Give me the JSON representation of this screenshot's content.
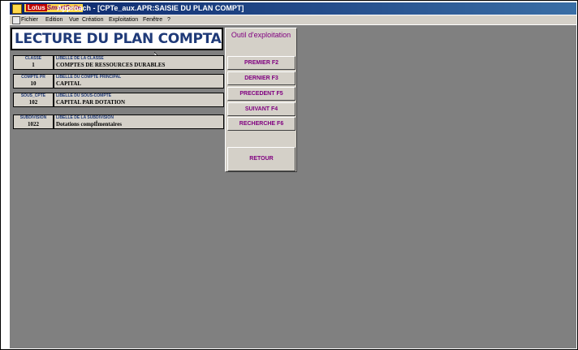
{
  "window": {
    "brand_lotus": "Lotus",
    "brand_smart": "SmartSuite",
    "title": "Approach - [CPTe_aux.APR:SAISIE DU PLAN COMPT]"
  },
  "menu": [
    "Fichier",
    "Edition",
    "Vue",
    "Création",
    "Exploitation",
    "Fenêtre",
    "?"
  ],
  "page_title": "LECTURE DU PLAN COMPTABLE",
  "records": [
    {
      "code_label": "CLASSE",
      "code_value": "1",
      "lib_label": "LIBELLE DE LA CLASSE",
      "lib_value": "COMPTES DE RESSOURCES DURABLES"
    },
    {
      "code_label": "COMPTE PR",
      "code_value": "10",
      "lib_label": "LIBELLE DU COMPTE PRINCIPAL",
      "lib_value": "CAPITAL"
    },
    {
      "code_label": "SOUS_CPTE",
      "code_value": "102",
      "lib_label": "LIBELLE DU SOUS-COMPTE",
      "lib_value": "CAPITAL PAR DOTATION"
    },
    {
      "code_label": "SUBDIVISION",
      "code_value": "1022",
      "lib_label": "LIBELLE DE LA SUBDIVISION",
      "lib_value": "Dotations complÎmentaires"
    }
  ],
  "tool_panel": {
    "title": "Outil d'exploitation",
    "buttons": [
      "PREMIER  F2",
      "DERNIER  F3",
      "PRECEDENT  F5",
      "SUIVANT  F4",
      "RECHERCHE  F6"
    ],
    "retour": "RETOUR"
  }
}
